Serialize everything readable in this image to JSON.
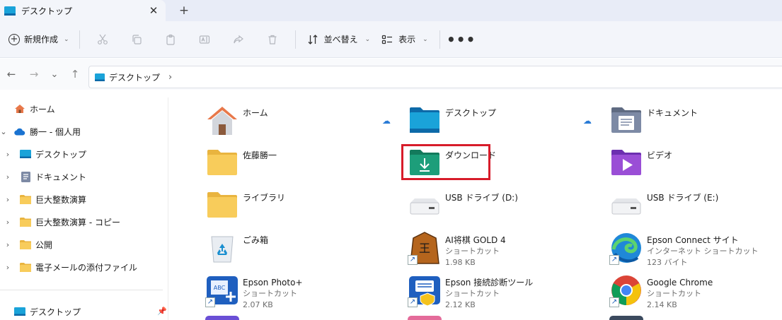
{
  "tab": {
    "title": "デスクトップ",
    "close": "✕",
    "new_tab": "+"
  },
  "toolbar": {
    "new_label": "新規作成",
    "sort_label": "並べ替え",
    "view_label": "表示",
    "more": "•••"
  },
  "address": {
    "crumb": "デスクトップ",
    "separator": "›"
  },
  "nav": {
    "back": "←",
    "forward": "→",
    "recent": "⌄",
    "up": "↑"
  },
  "sidebar": {
    "items": [
      {
        "label": "ホーム"
      },
      {
        "label": "勝一 - 個人用"
      },
      {
        "label": "デスクトップ"
      },
      {
        "label": "ドキュメント"
      },
      {
        "label": "巨大整数演算"
      },
      {
        "label": "巨大整数演算 - コピー"
      },
      {
        "label": "公開"
      },
      {
        "label": "電子メールの添付ファイル"
      }
    ],
    "quick": {
      "label": "デスクトップ"
    }
  },
  "files": {
    "home": {
      "name": "ホーム"
    },
    "desktop": {
      "name": "デスクトップ"
    },
    "documents": {
      "name": "ドキュメント"
    },
    "user": {
      "name": "佐藤勝一"
    },
    "downloads": {
      "name": "ダウンロード"
    },
    "videos": {
      "name": "ビデオ"
    },
    "library": {
      "name": "ライブラリ"
    },
    "usb_d": {
      "name": "USB ドライブ (D:)"
    },
    "usb_e": {
      "name": "USB ドライブ (E:)"
    },
    "trash": {
      "name": "ごみ箱"
    },
    "shogi": {
      "name": "AI将棋 GOLD 4",
      "type": "ショートカット",
      "size": "1.98 KB"
    },
    "epson_connect": {
      "name": "Epson Connect サイト",
      "type": "インターネット ショートカット",
      "size": "123 バイト"
    },
    "epson_photo": {
      "name": "Epson Photo+",
      "type": "ショートカット",
      "size": "2.07 KB"
    },
    "epson_diag": {
      "name": "Epson 接続診断ツール",
      "type": "ショートカット",
      "size": "2.12 KB"
    },
    "chrome": {
      "name": "Google Chrome",
      "type": "ショートカット",
      "size": "2.14 KB"
    }
  },
  "colors": {
    "accent": "#0067c0",
    "highlight": "#d71c2a",
    "folder": "#f7c948"
  }
}
